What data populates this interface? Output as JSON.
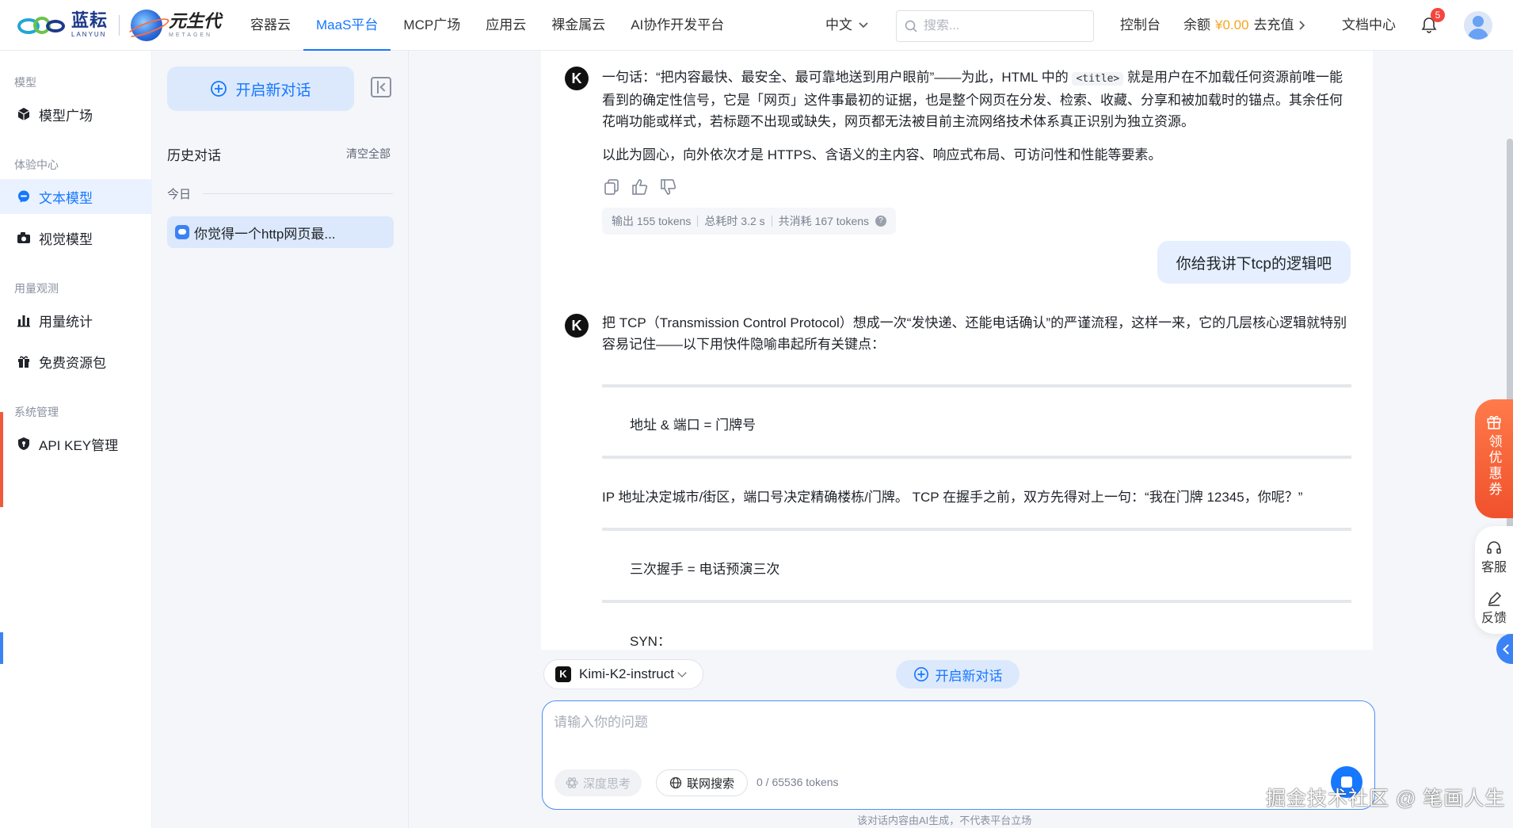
{
  "brand": {
    "logo1_cn": "蓝耘",
    "logo1_en": "LANYUN",
    "logo2_cn": "元生代",
    "logo2_en": "METAGEN"
  },
  "nav": {
    "links": [
      "容器云",
      "MaaS平台",
      "MCP广场",
      "应用云",
      "裸金属云",
      "AI协作开发平台"
    ],
    "active": "MaaS平台",
    "lang": "中文",
    "search_placeholder": "搜索...",
    "console": "控制台",
    "balance_label": "余额",
    "balance_amount": "¥0.00",
    "recharge": "去充值",
    "docs": "文档中心",
    "notification_count": "5"
  },
  "sidebar": {
    "groups": [
      "模型",
      "体验中心",
      "用量观测",
      "系统管理"
    ],
    "items": [
      "模型广场",
      "文本模型",
      "视觉模型",
      "用量统计",
      "免费资源包",
      "API KEY管理"
    ],
    "active": "文本模型"
  },
  "history": {
    "new_chat": "开启新对话",
    "title": "历史对话",
    "clear_all": "清空全部",
    "today": "今日",
    "items": [
      "你觉得一个http网页最..."
    ]
  },
  "chat": {
    "ai_message_1": {
      "p1_a": "一句话：“把内容最快、最安全、最可靠地送到用户眼前”——为此，HTML 中的",
      "p1_code": "<title>",
      "p1_b": "就是用户在不加载任何资源前唯一能看到的确定性信号，它是「网页」这件事最初的证据，也是整个网页在分发、检索、收藏、分享和被加载时的锚点。其余任何花哨功能或样式，若标题不出现或缺失，网页都无法被目前主流网络技术体系真正识别为独立资源。",
      "p2": "以此为圆心，向外依次才是 HTTPS、含语义的主内容、响应式布局、可访问性和性能等要素。",
      "tokens": {
        "output": "输出 155 tokens",
        "time": "总耗时 3.2 s",
        "total": "共消耗 167 tokens"
      }
    },
    "user_message": "你给我讲下tcp的逻辑吧",
    "ai_message_2": {
      "intro": "把 TCP（Transmission Control Protocol）想成一次“发快递、还能电话确认”的严谨流程，这样一来，它的几层核心逻辑就特别容易记住——以下用快件隐喻串起所有关键点：",
      "h1": "地址 & 端口 = 门牌号",
      "body1": "IP 地址决定城市/街区，端口号决定精确楼栋/门牌。 TCP 在握手之前，双方先得对上一句：“我在门牌 12345，你呢？”",
      "h2": "三次握手 = 电话预演三次",
      "syn": "SYN："
    }
  },
  "composer": {
    "model": "Kimi-K2-instruct",
    "model_badge": "K",
    "ai_avatar": "K",
    "new_chat": "开启新对话",
    "placeholder": "请输入你的问题",
    "deep_think": "深度思考",
    "web_search": "联网搜索",
    "token_count": "0 / 65536 tokens",
    "disclaimer": "该对话内容由AI生成，不代表平台立场"
  },
  "float": {
    "coupon": "领优惠券",
    "service": "客服",
    "feedback": "反馈"
  },
  "watermark": "掘金技术社区 @ 笔画人生",
  "colors": {
    "accent": "#1677ff",
    "active_bg": "#eaf2ff",
    "coupon": "#f0512c",
    "balance": "#f5a623"
  }
}
